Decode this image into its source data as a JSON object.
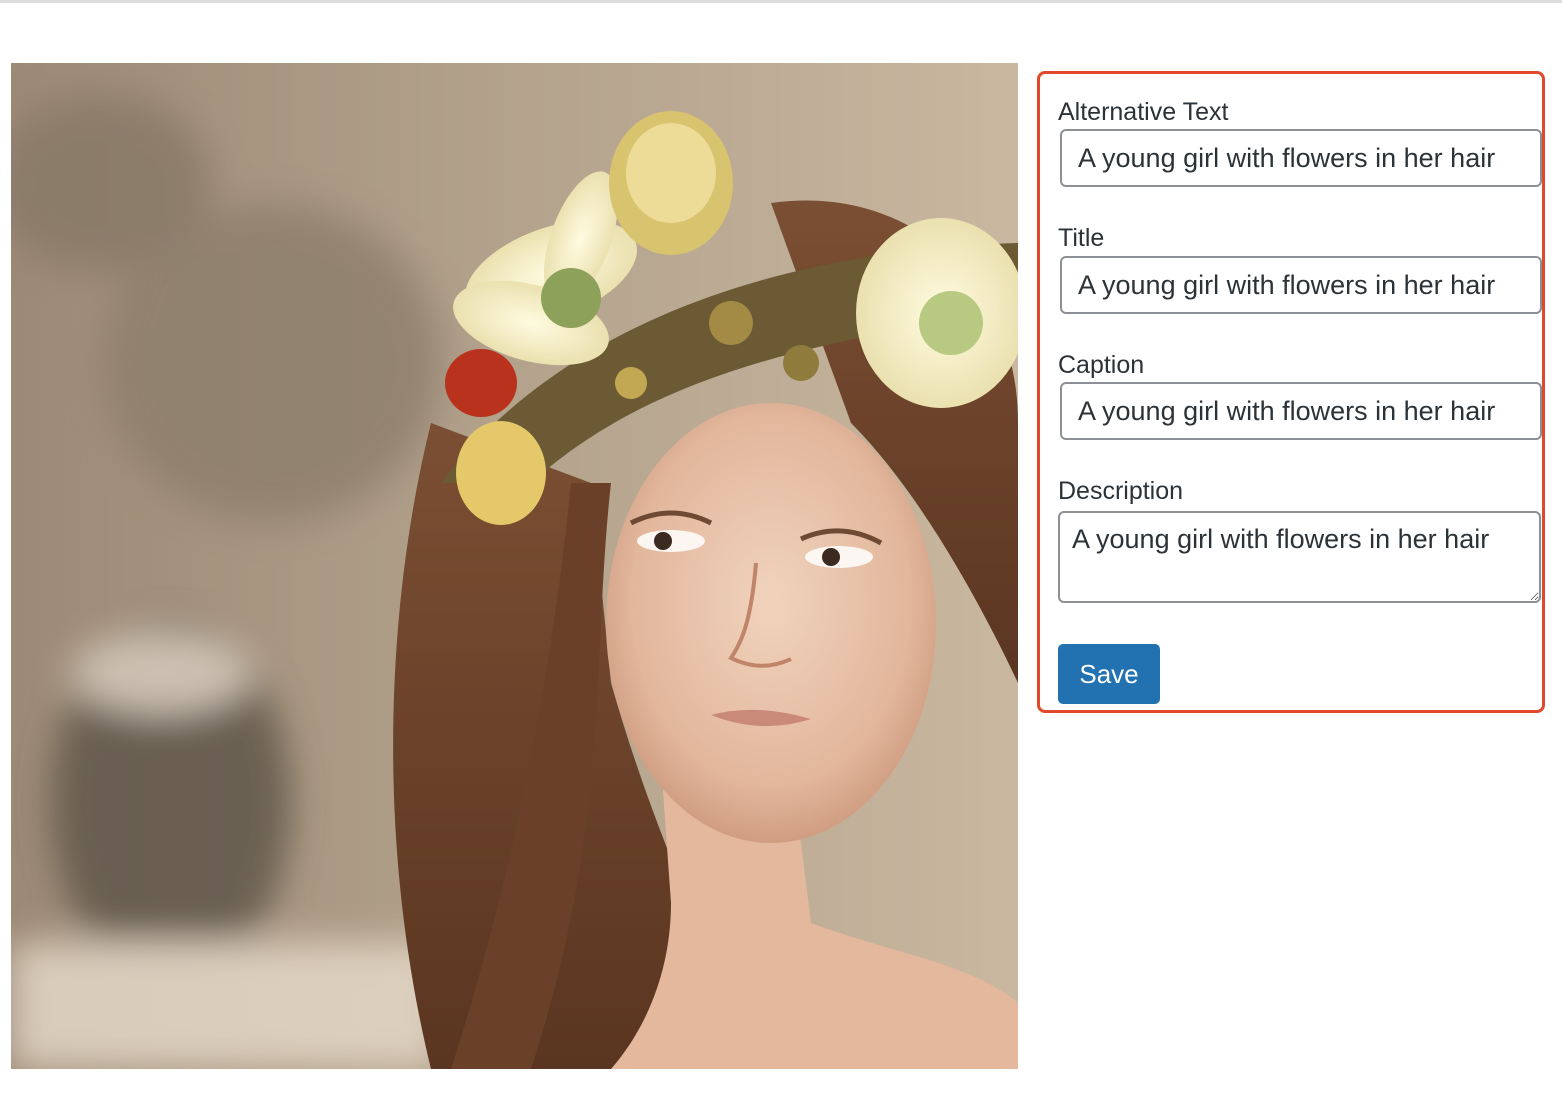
{
  "image_preview": {
    "alt": "A young girl with flowers in her hair"
  },
  "attachment_details": {
    "alt_text": {
      "label": "Alternative Text",
      "value": "A young girl with flowers in her hair"
    },
    "title": {
      "label": "Title",
      "value": "A young girl with flowers in her hair"
    },
    "caption": {
      "label": "Caption",
      "value": "A young girl with flowers in her hair"
    },
    "description": {
      "label": "Description",
      "value": "A young girl with flowers in her hair"
    },
    "save_label": "Save"
  },
  "colors": {
    "highlight_border": "#e2492c",
    "primary_button": "#2271b1",
    "input_border": "#8c8f94"
  }
}
